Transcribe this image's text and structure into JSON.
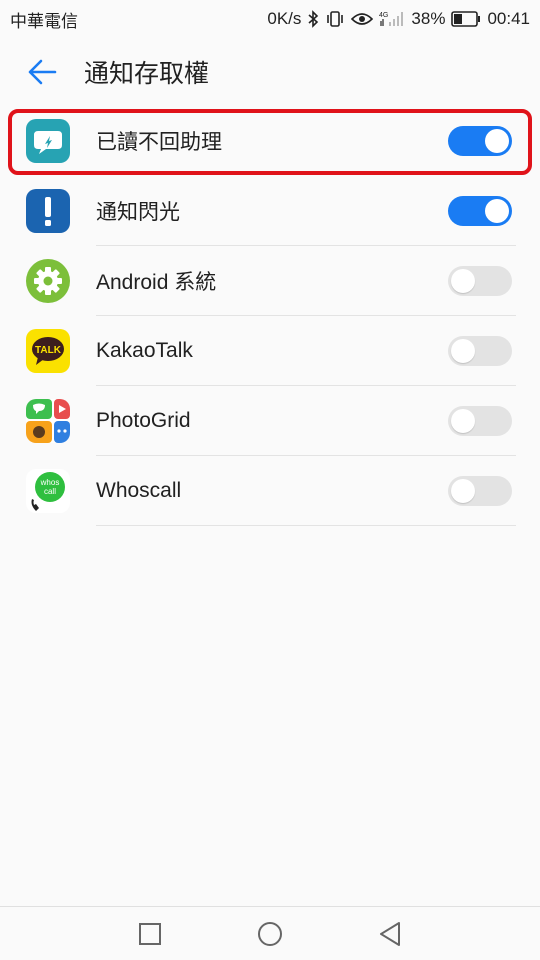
{
  "status": {
    "carrier": "中華電信",
    "speed": "0K/s",
    "network": "4G",
    "battery": "38%",
    "time": "00:41"
  },
  "header": {
    "title": "通知存取權"
  },
  "apps": [
    {
      "name": "已讀不回助理",
      "enabled": true,
      "icon": "chat-bubble-icon",
      "color": "#27a3b3"
    },
    {
      "name": "通知閃光",
      "enabled": true,
      "icon": "exclamation-icon",
      "color": "#1b64b0"
    },
    {
      "name": "Android 系統",
      "enabled": false,
      "icon": "gear-icon",
      "color": "#7cbf3a"
    },
    {
      "name": "KakaoTalk",
      "enabled": false,
      "icon": "talk-bubble-icon",
      "color": "#fae100"
    },
    {
      "name": "PhotoGrid",
      "enabled": false,
      "icon": "photogrid-icon",
      "color": "#e84e4e"
    },
    {
      "name": "Whoscall",
      "enabled": false,
      "icon": "whoscall-icon",
      "color": "#2fbf3f"
    }
  ],
  "icon_text": {
    "talk": "TALK",
    "whos": "whos",
    "call": "call"
  },
  "colors": {
    "accent": "#1a7cf3",
    "highlight": "#e0131a"
  }
}
